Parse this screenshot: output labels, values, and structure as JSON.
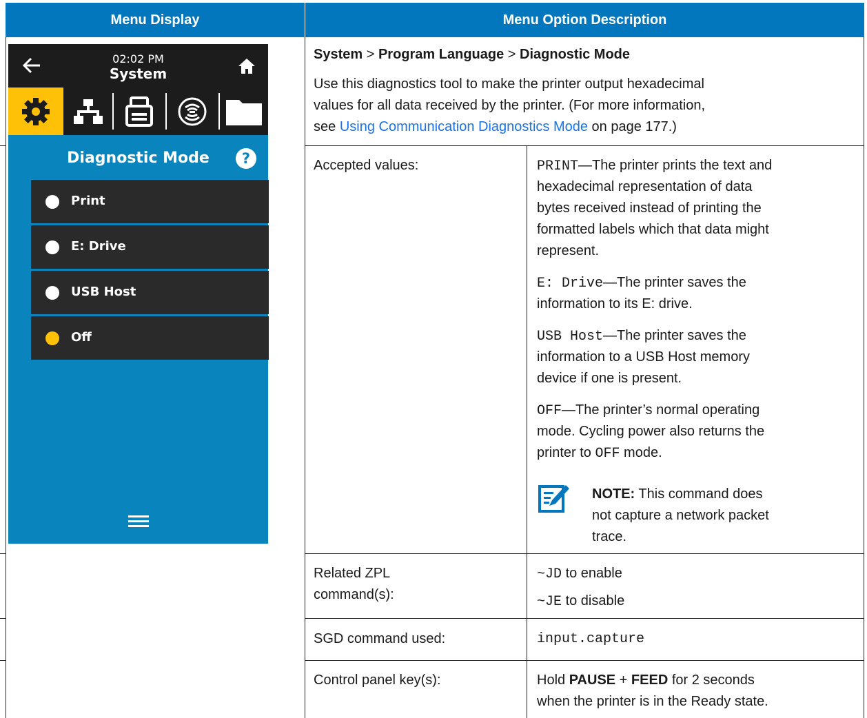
{
  "header": {
    "left": "Menu Display",
    "right": "Menu Option Description"
  },
  "device": {
    "time": "02:02 PM",
    "title": "System",
    "menu_title": "Diagnostic Mode",
    "options": [
      {
        "label": "Print",
        "selected": false
      },
      {
        "label": "E: Drive",
        "selected": false
      },
      {
        "label": "USB Host",
        "selected": false
      },
      {
        "label": "Off",
        "selected": true
      }
    ],
    "colors": {
      "screen": "#0a84bd",
      "bar": "#1c1c1c",
      "selected_tab": "#ffc107",
      "selected_dot": "#ffc107"
    }
  },
  "desc": {
    "breadcrumb": {
      "a": "System",
      "sep1": " > ",
      "b": "Program Language",
      "sep2": " > ",
      "c": "Diagnostic Mode"
    },
    "intro_1": "Use this diagnostics tool to make the printer output hexadecimal",
    "intro_2": "values for all data received by the printer. (For more information,",
    "intro_3a": "see ",
    "intro_link": "Using Communication Diagnostics Mode",
    "intro_3b": " on page 177.)",
    "accepted_label": "Accepted values:",
    "print_code": "PRINT",
    "print_text_1": "—The printer prints the text and",
    "print_text_2": "hexadecimal representation of data",
    "print_text_3": "bytes received instead of printing the",
    "print_text_4": "formatted labels which that data might",
    "print_text_5": "represent.",
    "edrive_code": "E: Drive",
    "edrive_text_1": "—The printer saves the",
    "edrive_text_2": "information to its E: drive.",
    "usb_code": "USB Host",
    "usb_text_1": "—The printer saves the",
    "usb_text_2": "information to a USB Host memory",
    "usb_text_3": "device if one is present.",
    "off_code": "OFF",
    "off_text_1": "—The printer’s normal operating",
    "off_text_2": "mode. Cycling power also returns the",
    "off_text_3a": "printer to ",
    "off_code_2": "OFF",
    "off_text_3b": " mode.",
    "note_bold": "NOTE:",
    "note_1": " This command does",
    "note_2": "not capture a network packet",
    "note_3": "trace.",
    "zpl_label_1": "Related ZPL",
    "zpl_label_2": "command(s):",
    "zpl_1_code": "~JD",
    "zpl_1_text": " to enable",
    "zpl_2_code": "~JE",
    "zpl_2_text": " to disable",
    "sgd_label": "SGD command used:",
    "sgd_value": "input.capture",
    "keys_label": "Control panel key(s):",
    "keys_1a": "Hold ",
    "keys_pause": "PAUSE",
    "keys_plus": " + ",
    "keys_feed": "FEED",
    "keys_1b": " for 2 seconds",
    "keys_2": "when the printer is in the Ready state."
  }
}
